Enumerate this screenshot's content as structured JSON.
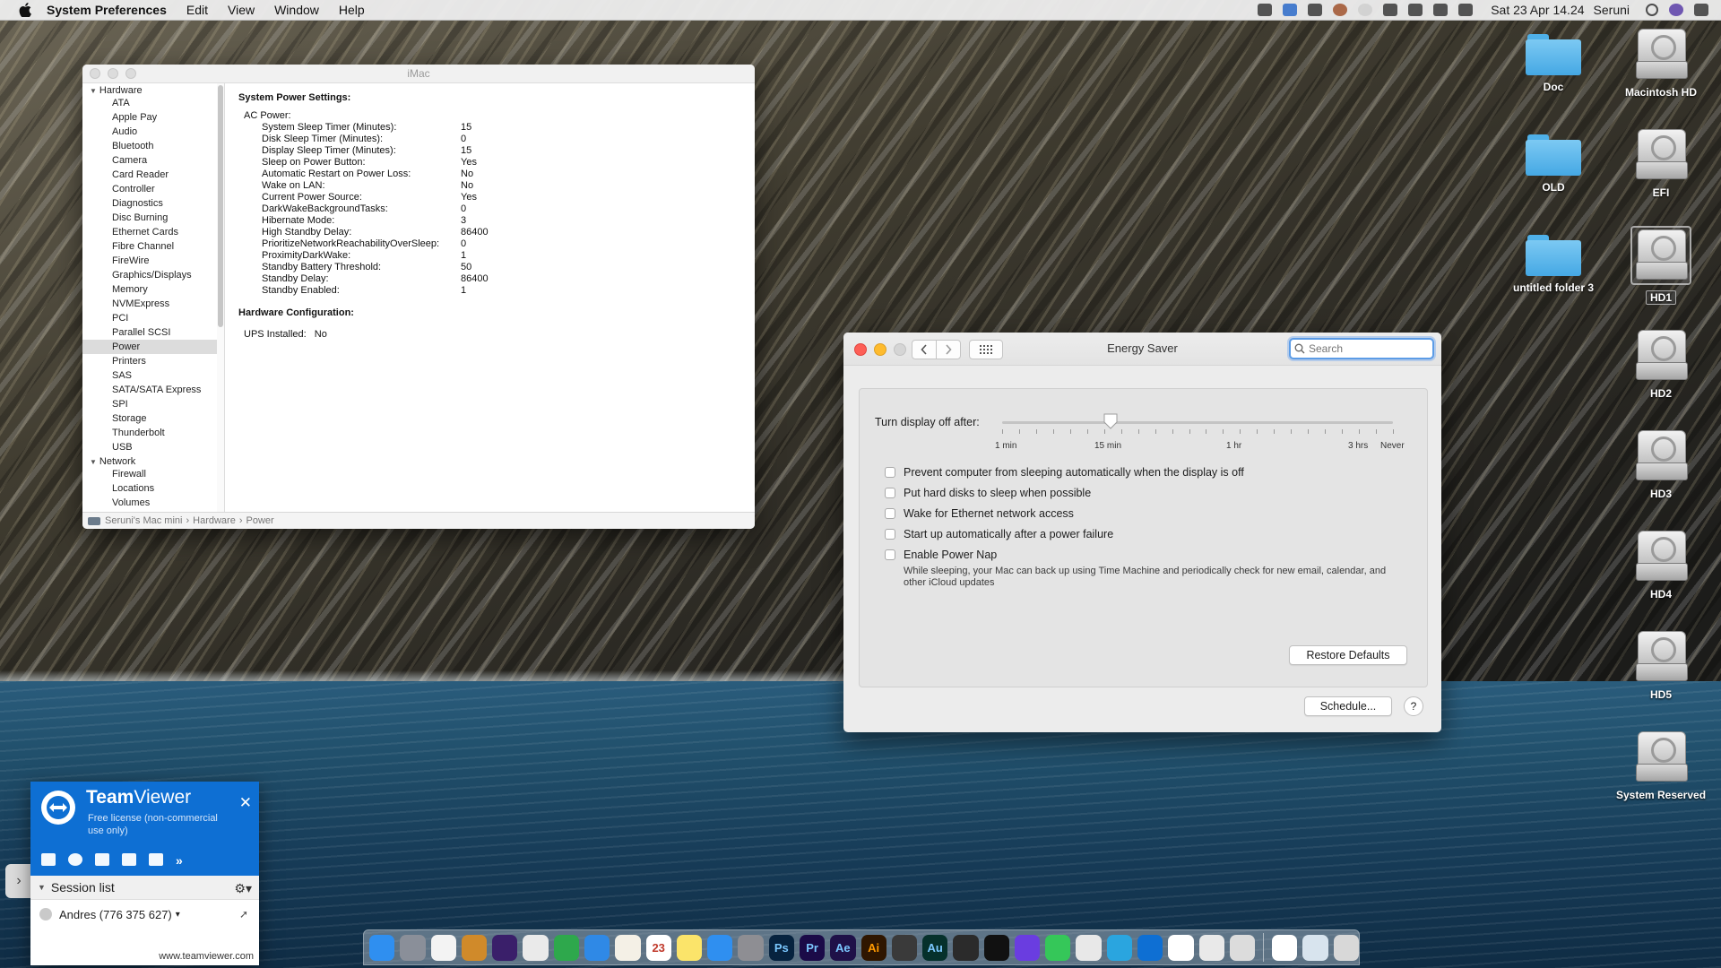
{
  "menubar": {
    "app_name": "System Preferences",
    "menus": [
      "Edit",
      "View",
      "Window",
      "Help"
    ],
    "clock": "Sat 23 Apr  14.24",
    "user": "Seruni"
  },
  "desktop": {
    "folders": [
      "Doc",
      "OLD",
      "untitled folder 3"
    ],
    "drives": [
      "Macintosh HD",
      "EFI",
      "HD1",
      "HD2",
      "HD3",
      "HD4",
      "HD5",
      "System Reserved"
    ]
  },
  "sysinfo": {
    "title": "iMac",
    "sidebar": {
      "hardware_label": "Hardware",
      "hardware_items": [
        "ATA",
        "Apple Pay",
        "Audio",
        "Bluetooth",
        "Camera",
        "Card Reader",
        "Controller",
        "Diagnostics",
        "Disc Burning",
        "Ethernet Cards",
        "Fibre Channel",
        "FireWire",
        "Graphics/Displays",
        "Memory",
        "NVMExpress",
        "PCI",
        "Parallel SCSI",
        "Power",
        "Printers",
        "SAS",
        "SATA/SATA Express",
        "SPI",
        "Storage",
        "Thunderbolt",
        "USB"
      ],
      "selected": "Power",
      "network_label": "Network",
      "network_items": [
        "Firewall",
        "Locations",
        "Volumes"
      ]
    },
    "content": {
      "power_heading": "System Power Settings:",
      "ac_power_label": "AC Power:",
      "settings": [
        {
          "k": "System Sleep Timer (Minutes):",
          "v": "15"
        },
        {
          "k": "Disk Sleep Timer (Minutes):",
          "v": "0"
        },
        {
          "k": "Display Sleep Timer (Minutes):",
          "v": "15"
        },
        {
          "k": "Sleep on Power Button:",
          "v": "Yes"
        },
        {
          "k": "Automatic Restart on Power Loss:",
          "v": "No"
        },
        {
          "k": "Wake on LAN:",
          "v": "No"
        },
        {
          "k": "Current Power Source:",
          "v": "Yes"
        },
        {
          "k": "DarkWakeBackgroundTasks:",
          "v": "0"
        },
        {
          "k": "Hibernate Mode:",
          "v": "3"
        },
        {
          "k": "High Standby Delay:",
          "v": "86400"
        },
        {
          "k": "PrioritizeNetworkReachabilityOverSleep:",
          "v": "0"
        },
        {
          "k": "ProximityDarkWake:",
          "v": "1"
        },
        {
          "k": "Standby Battery Threshold:",
          "v": "50"
        },
        {
          "k": "Standby Delay:",
          "v": "86400"
        },
        {
          "k": "Standby Enabled:",
          "v": "1"
        }
      ],
      "hw_heading": "Hardware Configuration:",
      "ups_label": "UPS Installed:",
      "ups_value": "No"
    },
    "pathbar": [
      "Seruni's Mac mini",
      "Hardware",
      "Power"
    ]
  },
  "energy": {
    "title": "Energy Saver",
    "search_placeholder": "Search",
    "slider_label": "Turn display off after:",
    "slider_value_label": "15 min",
    "slider_ticks": [
      "1 min",
      "15 min",
      "1 hr",
      "3 hrs",
      "Never"
    ],
    "options": [
      {
        "label": "Prevent computer from sleeping automatically when the display is off",
        "checked": false
      },
      {
        "label": "Put hard disks to sleep when possible",
        "checked": false
      },
      {
        "label": "Wake for Ethernet network access",
        "checked": false
      },
      {
        "label": "Start up automatically after a power failure",
        "checked": false
      },
      {
        "label": "Enable Power Nap",
        "checked": false
      }
    ],
    "power_nap_desc": "While sleeping, your Mac can back up using Time Machine and periodically check for new email, calendar, and other iCloud updates",
    "restore_defaults": "Restore Defaults",
    "schedule": "Schedule...",
    "help": "?"
  },
  "teamviewer": {
    "brand_bold": "Team",
    "brand_rest": "Viewer",
    "license": "Free license (non-commercial use only)",
    "session_list": "Session list",
    "contact": "Andres (776 375 627)",
    "url": "www.teamviewer.com"
  },
  "dock": {
    "apps": [
      {
        "name": "finder",
        "color": "#2f8ff0",
        "label": ""
      },
      {
        "name": "launchpad",
        "color": "#8a8f99",
        "label": ""
      },
      {
        "name": "sublime",
        "color": "#f3f3f3",
        "label": ""
      },
      {
        "name": "game",
        "color": "#d08a2a",
        "label": ""
      },
      {
        "name": "app",
        "color": "#3a1f6a",
        "label": ""
      },
      {
        "name": "configurator",
        "color": "#eaeaea",
        "label": ""
      },
      {
        "name": "numbers",
        "color": "#2ea84c",
        "label": ""
      },
      {
        "name": "safari",
        "color": "#2f89e6",
        "label": ""
      },
      {
        "name": "notes",
        "color": "#f4f0e6",
        "label": ""
      },
      {
        "name": "calendar",
        "color": "#ffffff",
        "label": "23"
      },
      {
        "name": "stickies",
        "color": "#fbe46a",
        "label": ""
      },
      {
        "name": "app-store",
        "color": "#2f8ff0",
        "label": ""
      },
      {
        "name": "system-preferences",
        "color": "#8e8e93",
        "label": ""
      },
      {
        "name": "photoshop",
        "color": "#07233f",
        "label": "Ps"
      },
      {
        "name": "premiere",
        "color": "#1b0b48",
        "label": "Pr"
      },
      {
        "name": "after-effects",
        "color": "#1f1148",
        "label": "Ae"
      },
      {
        "name": "illustrator",
        "color": "#2f1600",
        "label": "Ai"
      },
      {
        "name": "final-cut",
        "color": "#3a3a3a",
        "label": ""
      },
      {
        "name": "audition",
        "color": "#06312c",
        "label": "Au"
      },
      {
        "name": "app2",
        "color": "#2b2b2b",
        "label": ""
      },
      {
        "name": "aperture",
        "color": "#111111",
        "label": ""
      },
      {
        "name": "app3",
        "color": "#6a3de0",
        "label": ""
      },
      {
        "name": "messages",
        "color": "#35c759",
        "label": ""
      },
      {
        "name": "chrome",
        "color": "#e8e8e8",
        "label": ""
      },
      {
        "name": "telegram",
        "color": "#2aa5df",
        "label": ""
      },
      {
        "name": "teamviewer",
        "color": "#0e6fd3",
        "label": ""
      },
      {
        "name": "app4",
        "color": "#ffffff",
        "label": ""
      },
      {
        "name": "app5",
        "color": "#e9e9e9",
        "label": ""
      },
      {
        "name": "app6",
        "color": "#dcdcdc",
        "label": ""
      },
      {
        "name": "document",
        "color": "#ffffff",
        "label": ""
      },
      {
        "name": "downloads",
        "color": "#d8e4ee",
        "label": ""
      },
      {
        "name": "trash",
        "color": "#d8d8d8",
        "label": ""
      }
    ]
  }
}
